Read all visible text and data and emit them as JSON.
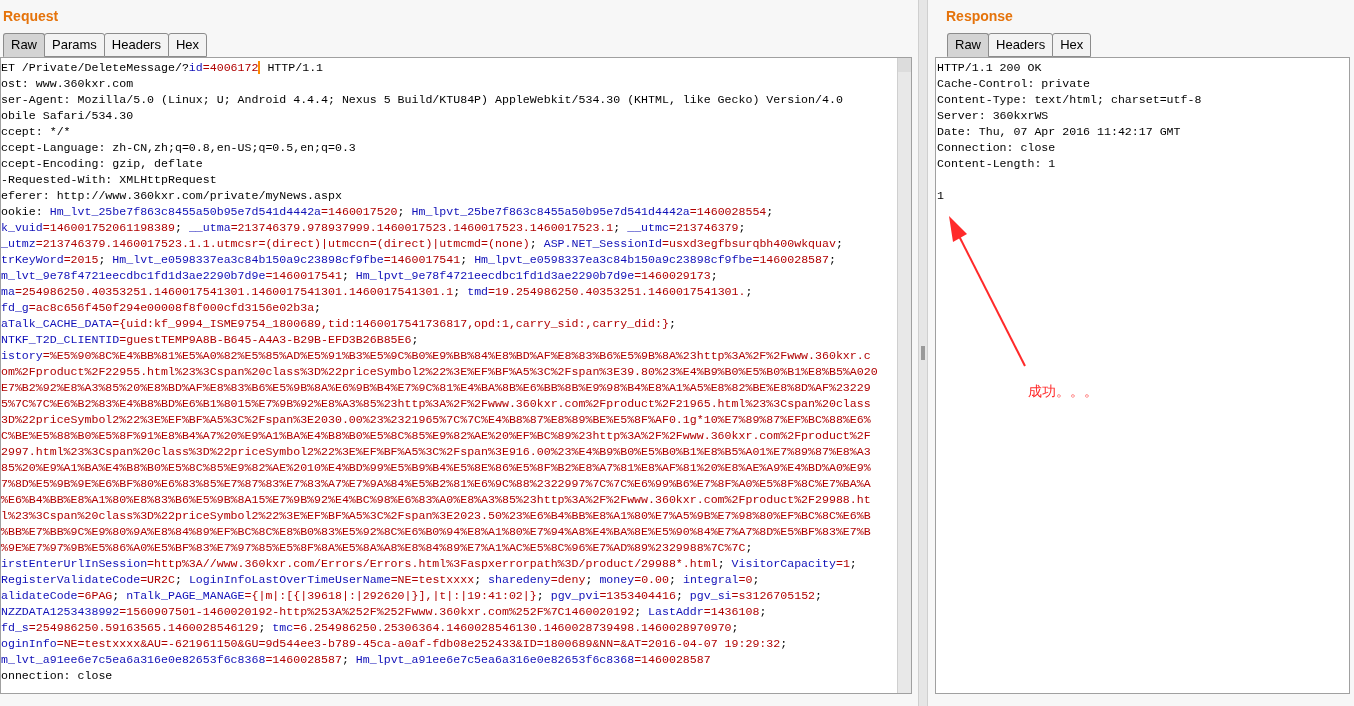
{
  "request": {
    "title": "Request",
    "tabs": [
      {
        "label": "Raw",
        "selected": true
      },
      {
        "label": "Params",
        "selected": false
      },
      {
        "label": "Headers",
        "selected": false
      },
      {
        "label": "Hex",
        "selected": false
      }
    ],
    "lines": [
      {
        "segments": [
          {
            "text": "ET /Private/DeleteMessage/?",
            "kind": "plain"
          },
          {
            "text": "id",
            "kind": "name"
          },
          {
            "text": "=4006172",
            "kind": "value"
          },
          {
            "kind": "caret"
          },
          {
            "text": " HTTP/1.1",
            "kind": "plain"
          }
        ]
      },
      {
        "segments": [
          {
            "text": "ost: www.360kxr.com",
            "kind": "plain"
          }
        ]
      },
      {
        "segments": [
          {
            "text": "ser-Agent: Mozilla/5.0 (Linux; U; Android 4.4.4; Nexus 5 Build/KTU84P) AppleWebkit/534.30 (KHTML, like Gecko) Version/4.0",
            "kind": "plain"
          }
        ]
      },
      {
        "segments": [
          {
            "text": "obile Safari/534.30",
            "kind": "plain"
          }
        ]
      },
      {
        "segments": [
          {
            "text": "ccept: */*",
            "kind": "plain"
          }
        ]
      },
      {
        "segments": [
          {
            "text": "ccept-Language: zh-CN,zh;q=0.8,en-US;q=0.5,en;q=0.3",
            "kind": "plain"
          }
        ]
      },
      {
        "segments": [
          {
            "text": "ccept-Encoding: gzip, deflate",
            "kind": "plain"
          }
        ]
      },
      {
        "segments": [
          {
            "text": "-Requested-With: XMLHttpRequest",
            "kind": "plain"
          }
        ]
      },
      {
        "segments": [
          {
            "text": "eferer: http://www.360kxr.com/private/myNews.aspx",
            "kind": "plain"
          }
        ]
      },
      {
        "segments": [
          {
            "text": "ookie: ",
            "kind": "plain"
          },
          {
            "text": "Hm_lvt_25be7f863c8455a50b95e7d541d4442a",
            "kind": "name"
          },
          {
            "text": "=1460017520",
            "kind": "value"
          },
          {
            "text": "; ",
            "kind": "plain"
          },
          {
            "text": "Hm_lpvt_25be7f863c8455a50b95e7d541d4442a",
            "kind": "name"
          },
          {
            "text": "=1460028554",
            "kind": "value"
          },
          {
            "text": ";",
            "kind": "plain"
          }
        ]
      },
      {
        "segments": [
          {
            "text": "k_vuid",
            "kind": "name"
          },
          {
            "text": "=146001752061198389",
            "kind": "value"
          },
          {
            "text": "; ",
            "kind": "plain"
          },
          {
            "text": "__utma",
            "kind": "name"
          },
          {
            "text": "=213746379.978937999.1460017523.1460017523.1460017523.1",
            "kind": "value"
          },
          {
            "text": "; ",
            "kind": "plain"
          },
          {
            "text": "__utmc",
            "kind": "name"
          },
          {
            "text": "=213746379",
            "kind": "value"
          },
          {
            "text": ";",
            "kind": "plain"
          }
        ]
      },
      {
        "segments": [
          {
            "text": "_utmz",
            "kind": "name"
          },
          {
            "text": "=213746379.1460017523.1.1.utmcsr=(direct)|utmccn=(direct)|utmcmd=(none)",
            "kind": "value"
          },
          {
            "text": "; ",
            "kind": "plain"
          },
          {
            "text": "ASP.NET_SessionId",
            "kind": "name"
          },
          {
            "text": "=usxd3egfbsurqbh400wkquav",
            "kind": "value"
          },
          {
            "text": ";",
            "kind": "plain"
          }
        ]
      },
      {
        "segments": [
          {
            "text": "trKeyWord",
            "kind": "name"
          },
          {
            "text": "=2015",
            "kind": "value"
          },
          {
            "text": "; ",
            "kind": "plain"
          },
          {
            "text": "Hm_lvt_e0598337ea3c84b150a9c23898cf9fbe",
            "kind": "name"
          },
          {
            "text": "=1460017541",
            "kind": "value"
          },
          {
            "text": "; ",
            "kind": "plain"
          },
          {
            "text": "Hm_lpvt_e0598337ea3c84b150a9c23898cf9fbe",
            "kind": "name"
          },
          {
            "text": "=1460028587",
            "kind": "value"
          },
          {
            "text": ";",
            "kind": "plain"
          }
        ]
      },
      {
        "segments": [
          {
            "text": "m_lvt_9e78f4721eecdbc1fd1d3ae2290b7d9e",
            "kind": "name"
          },
          {
            "text": "=1460017541",
            "kind": "value"
          },
          {
            "text": "; ",
            "kind": "plain"
          },
          {
            "text": "Hm_lpvt_9e78f4721eecdbc1fd1d3ae2290b7d9e",
            "kind": "name"
          },
          {
            "text": "=1460029173",
            "kind": "value"
          },
          {
            "text": ";",
            "kind": "plain"
          }
        ]
      },
      {
        "segments": [
          {
            "text": "ma",
            "kind": "name"
          },
          {
            "text": "=254986250.40353251.1460017541301.1460017541301.1460017541301.1",
            "kind": "value"
          },
          {
            "text": "; ",
            "kind": "plain"
          },
          {
            "text": "tmd",
            "kind": "name"
          },
          {
            "text": "=19.254986250.40353251.1460017541301.",
            "kind": "value"
          },
          {
            "text": ";",
            "kind": "plain"
          }
        ]
      },
      {
        "segments": [
          {
            "text": "fd_g",
            "kind": "name"
          },
          {
            "text": "=ac8c656f450f294e00008f8f000cfd3156e02b3a",
            "kind": "value"
          },
          {
            "text": ";",
            "kind": "plain"
          }
        ]
      },
      {
        "segments": [
          {
            "text": "aTalk_CACHE_DATA",
            "kind": "name"
          },
          {
            "text": "={uid:kf_9994_ISME9754_1800689,tid:1460017541736817,opd:1,carry_sid:,carry_did:}",
            "kind": "value"
          },
          {
            "text": ";",
            "kind": "plain"
          }
        ]
      },
      {
        "segments": [
          {
            "text": "NTKF_T2D_CLIENTID",
            "kind": "name"
          },
          {
            "text": "=guestTEMP9A8B-B645-A4A3-B29B-EFD3B26B85E6",
            "kind": "value"
          },
          {
            "text": ";",
            "kind": "plain"
          }
        ]
      },
      {
        "segments": [
          {
            "text": "istory",
            "kind": "name"
          },
          {
            "text": "=%E5%90%8C%E4%BB%81%E5%A0%82%E5%85%AD%E5%91%B3%E5%9C%B0%E9%BB%84%E8%BD%AF%E8%83%B6%E5%9B%8A%23http%3A%2F%2Fwww.360kxr.c",
            "kind": "value"
          }
        ]
      },
      {
        "segments": [
          {
            "text": "om%2Fproduct%2F22955.html%23%3Cspan%20class%3D%22priceSymbol2%22%3E%EF%BF%A5%3C%2Fspan%3E39.80%23%E4%B9%B0%E5%B0%B1%E8%B5%A020",
            "kind": "value"
          }
        ]
      },
      {
        "segments": [
          {
            "text": "E7%B2%92%E8%A3%85%20%E8%BD%AF%E8%83%B6%E5%9B%8A%E6%9B%B4%E7%9C%81%E4%BA%8B%E6%BB%8B%E9%98%B4%E8%A1%A5%E8%82%BE%E8%8D%AF%23229",
            "kind": "value"
          }
        ]
      },
      {
        "segments": [
          {
            "text": "5%7C%7C%E6%B2%83%E4%B8%BD%E6%B1%8015%E7%9B%92%E8%A3%85%23http%3A%2F%2Fwww.360kxr.com%2Fproduct%2F21965.html%23%3Cspan%20class",
            "kind": "value"
          }
        ]
      },
      {
        "segments": [
          {
            "text": "3D%22priceSymbol2%22%3E%EF%BF%A5%3C%2Fspan%3E2030.00%23%2321965%7C%7C%E4%B8%87%E8%89%BE%E5%8F%AF0.1g*10%E7%89%87%EF%BC%88%E6%",
            "kind": "value"
          }
        ]
      },
      {
        "segments": [
          {
            "text": "C%BE%E5%88%B0%E5%8F%91%E8%B4%A7%20%E9%A1%BA%E4%B8%B0%E5%8C%85%E9%82%AE%20%EF%BC%89%23http%3A%2F%2Fwww.360kxr.com%2Fproduct%2F",
            "kind": "value"
          }
        ]
      },
      {
        "segments": [
          {
            "text": "2997.html%23%3Cspan%20class%3D%22priceSymbol2%22%3E%EF%BF%A5%3C%2Fspan%3E916.00%23%E4%B9%B0%E5%B0%B1%E8%B5%A01%E7%89%87%E8%A3",
            "kind": "value"
          }
        ]
      },
      {
        "segments": [
          {
            "text": "85%20%E9%A1%BA%E4%B8%B0%E5%8C%85%E9%82%AE%2010%E4%BD%99%E5%B9%B4%E5%8E%86%E5%8F%B2%E8%A7%81%E8%AF%81%20%E8%AE%A9%E4%BD%A0%E9%",
            "kind": "value"
          }
        ]
      },
      {
        "segments": [
          {
            "text": "7%8D%E5%9B%9E%E6%BF%80%E6%83%85%E7%87%83%E7%83%A7%E7%9A%84%E5%B2%81%E6%9C%88%2322997%7C%7C%E6%99%B6%E7%8F%A0%E5%8F%8C%E7%BA%A",
            "kind": "value"
          }
        ]
      },
      {
        "segments": [
          {
            "text": "%E6%B4%BB%E8%A1%80%E8%83%B6%E5%9B%8A15%E7%9B%92%E4%BC%98%E6%83%A0%E8%A3%85%23http%3A%2F%2Fwww.360kxr.com%2Fproduct%2F29988.ht",
            "kind": "value"
          }
        ]
      },
      {
        "segments": [
          {
            "text": "l%23%3Cspan%20class%3D%22priceSymbol2%22%3E%EF%BF%A5%3C%2Fspan%3E2023.50%23%E6%B4%BB%E8%A1%80%E7%A5%9B%E7%98%80%EF%BC%8C%E6%B",
            "kind": "value"
          }
        ]
      },
      {
        "segments": [
          {
            "text": "%BB%E7%BB%9C%E9%80%9A%E8%84%89%EF%BC%8C%E8%B0%83%E5%92%8C%E6%B0%94%E8%A1%80%E7%94%A8%E4%BA%8E%E5%90%84%E7%A7%8D%E5%BF%83%E7%B",
            "kind": "value"
          }
        ]
      },
      {
        "segments": [
          {
            "text": "%9E%E7%97%9B%E5%86%A0%E5%BF%83%E7%97%85%E5%8F%8A%E5%8A%A8%E8%84%89%E7%A1%AC%E5%8C%96%E7%AD%89%2329988%7C%7C",
            "kind": "value"
          },
          {
            "text": ";",
            "kind": "plain"
          }
        ]
      },
      {
        "segments": [
          {
            "text": "irstEnterUrlInSession",
            "kind": "name"
          },
          {
            "text": "=http%3A//www.360kxr.com/Errors/Errors.html%3Faspxerrorpath%3D/product/29988*.html",
            "kind": "value"
          },
          {
            "text": "; ",
            "kind": "plain"
          },
          {
            "text": "VisitorCapacity",
            "kind": "name"
          },
          {
            "text": "=1",
            "kind": "value"
          },
          {
            "text": ";",
            "kind": "plain"
          }
        ]
      },
      {
        "segments": [
          {
            "text": "RegisterValidateCode",
            "kind": "name"
          },
          {
            "text": "=UR2C",
            "kind": "value"
          },
          {
            "text": "; ",
            "kind": "plain"
          },
          {
            "text": "LoginInfoLastOverTimeUserName",
            "kind": "name"
          },
          {
            "text": "=NE=testxxxx",
            "kind": "value"
          },
          {
            "text": "; ",
            "kind": "plain"
          },
          {
            "text": "sharedeny",
            "kind": "name"
          },
          {
            "text": "=deny",
            "kind": "value"
          },
          {
            "text": "; ",
            "kind": "plain"
          },
          {
            "text": "money",
            "kind": "name"
          },
          {
            "text": "=0.00",
            "kind": "value"
          },
          {
            "text": "; ",
            "kind": "plain"
          },
          {
            "text": "integral",
            "kind": "name"
          },
          {
            "text": "=0",
            "kind": "value"
          },
          {
            "text": ";",
            "kind": "plain"
          }
        ]
      },
      {
        "segments": [
          {
            "text": "alidateCode",
            "kind": "name"
          },
          {
            "text": "=6PAG",
            "kind": "value"
          },
          {
            "text": "; ",
            "kind": "plain"
          },
          {
            "text": "nTalk_PAGE_MANAGE",
            "kind": "name"
          },
          {
            "text": "={|m|:[{|39618|:|292620|}],|t|:|19:41:02|}",
            "kind": "value"
          },
          {
            "text": "; ",
            "kind": "plain"
          },
          {
            "text": "pgv_pvi",
            "kind": "name"
          },
          {
            "text": "=1353404416",
            "kind": "value"
          },
          {
            "text": "; ",
            "kind": "plain"
          },
          {
            "text": "pgv_si",
            "kind": "name"
          },
          {
            "text": "=s3126705152",
            "kind": "value"
          },
          {
            "text": ";",
            "kind": "plain"
          }
        ]
      },
      {
        "segments": [
          {
            "text": "NZZDATA1253438992",
            "kind": "name"
          },
          {
            "text": "=1560907501-1460020192-http%253A%252F%252Fwww.360kxr.com%252F%7C1460020192",
            "kind": "value"
          },
          {
            "text": "; ",
            "kind": "plain"
          },
          {
            "text": "LastAddr",
            "kind": "name"
          },
          {
            "text": "=1436108",
            "kind": "value"
          },
          {
            "text": ";",
            "kind": "plain"
          }
        ]
      },
      {
        "segments": [
          {
            "text": "fd_s",
            "kind": "name"
          },
          {
            "text": "=254986250.59163565.1460028546129",
            "kind": "value"
          },
          {
            "text": "; ",
            "kind": "plain"
          },
          {
            "text": "tmc",
            "kind": "name"
          },
          {
            "text": "=6.254986250.25306364.1460028546130.1460028739498.1460028970970",
            "kind": "value"
          },
          {
            "text": ";",
            "kind": "plain"
          }
        ]
      },
      {
        "segments": [
          {
            "text": "oginInfo",
            "kind": "name"
          },
          {
            "text": "=NE=testxxxx&AU=-621961150&GU=9d544ee3-b789-45ca-a0af-fdb08e252433&ID=1800689&NN=&AT=2016-04-07 19:29:32",
            "kind": "value"
          },
          {
            "text": ";",
            "kind": "plain"
          }
        ]
      },
      {
        "segments": [
          {
            "text": "m_lvt_a91ee6e7c5ea6a316e0e82653f6c8368",
            "kind": "name"
          },
          {
            "text": "=1460028587",
            "kind": "value"
          },
          {
            "text": "; ",
            "kind": "plain"
          },
          {
            "text": "Hm_lpvt_a91ee6e7c5ea6a316e0e82653f6c8368",
            "kind": "name"
          },
          {
            "text": "=1460028587",
            "kind": "value"
          }
        ]
      },
      {
        "segments": [
          {
            "text": "onnection: close",
            "kind": "plain"
          }
        ]
      }
    ]
  },
  "response": {
    "title": "Response",
    "tabs": [
      {
        "label": "Raw",
        "selected": true
      },
      {
        "label": "Headers",
        "selected": false
      },
      {
        "label": "Hex",
        "selected": false
      }
    ],
    "headers": [
      "HTTP/1.1 200 OK",
      "Cache-Control: private",
      "Content-Type: text/html; charset=utf-8",
      "Server: 360kxrWS",
      "Date: Thu, 07 Apr 2016 11:42:17 GMT",
      "Connection: close",
      "Content-Length: 1"
    ],
    "body": "1",
    "annotation": {
      "text": "成功。。。"
    }
  }
}
